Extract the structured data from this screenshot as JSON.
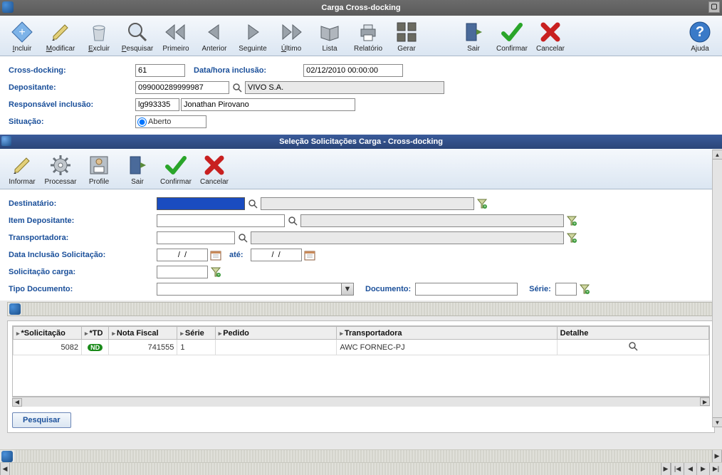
{
  "window": {
    "title": "Carga Cross-docking"
  },
  "toolbar_main": {
    "incluir": "Incluir",
    "modificar": "Modificar",
    "excluir": "Excluir",
    "pesquisar": "Pesquisar",
    "primeiro": "Primeiro",
    "anterior": "Anterior",
    "seguinte": "Seguinte",
    "ultimo": "Último",
    "lista": "Lista",
    "relatorio": "Relatório",
    "gerar": "Gerar",
    "sair": "Sair",
    "confirmar": "Confirmar",
    "cancelar": "Cancelar",
    "ajuda": "Ajuda"
  },
  "header_form": {
    "crossdocking_label": "Cross-docking:",
    "crossdocking_value": "61",
    "datahora_label": "Data/hora inclusão:",
    "datahora_value": "02/12/2010 00:00:00",
    "depositante_label": "Depositante:",
    "depositante_code": "099000289999987",
    "depositante_name": "VIVO S.A.",
    "responsavel_label": "Responsável inclusão:",
    "responsavel_code": "lg993335",
    "responsavel_name": "Jonathan Pirovano",
    "situacao_label": "Situação:",
    "situacao_value": "Aberto"
  },
  "sub_window": {
    "title": "Seleção Solicitações Carga - Cross-docking"
  },
  "toolbar_sub": {
    "informar": "Informar",
    "processar": "Processar",
    "profile": "Profile",
    "sair": "Sair",
    "confirmar": "Confirmar",
    "cancelar": "Cancelar"
  },
  "filter_form": {
    "destinatario_label": "Destinatário:",
    "item_depositante_label": "Item Depositante:",
    "transportadora_label": "Transportadora:",
    "data_inclusao_label": "Data Inclusão Solicitação:",
    "ate_label": "até:",
    "data_placeholder": "/  /",
    "solicitacao_carga_label": "Solicitação carga:",
    "tipo_documento_label": "Tipo Documento:",
    "documento_label": "Documento:",
    "serie_label": "Série:"
  },
  "grid": {
    "headers": {
      "solicitacao": "*Solicitação",
      "td": "*TD",
      "nota_fiscal": "Nota Fiscal",
      "serie": "Série",
      "pedido": "Pedido",
      "transportadora": "Transportadora",
      "detalhe": "Detalhe"
    },
    "rows": [
      {
        "solicitacao": "5082",
        "td_badge": "ND",
        "nota_fiscal": "741555",
        "serie": "1",
        "pedido": "",
        "transportadora": "AWC FORNEC-PJ",
        "detalhe": ""
      }
    ]
  },
  "buttons": {
    "pesquisar": "Pesquisar"
  }
}
